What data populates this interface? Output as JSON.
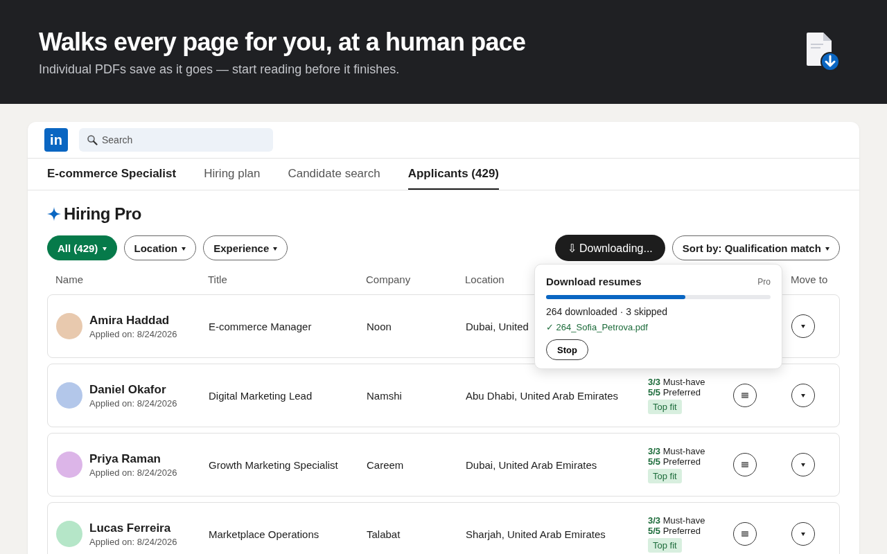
{
  "banner": {
    "headline": "Walks every page for you, at a human pace",
    "subtitle": "Individual PDFs save as it goes — start reading before it finishes."
  },
  "topbar": {
    "logo": "in",
    "search": {
      "placeholder": "Search"
    }
  },
  "tabs": [
    {
      "label": "E-commerce Specialist",
      "kind": "job",
      "selected": false
    },
    {
      "label": "Hiring plan",
      "kind": "tab",
      "selected": false
    },
    {
      "label": "Candidate search",
      "kind": "tab",
      "selected": false
    },
    {
      "label": "Applicants (429)",
      "kind": "tab",
      "selected": true
    }
  ],
  "section_title": "Hiring Pro",
  "filters": [
    {
      "label": "All (429)",
      "selected": true
    },
    {
      "label": "Location",
      "selected": false
    },
    {
      "label": "Experience",
      "selected": false
    }
  ],
  "download_button": "⇩ Downloading...",
  "sort_button": "Sort by: Qualification match",
  "columns": [
    "Name",
    "Title",
    "Company",
    "Location",
    "Move to"
  ],
  "applicants": [
    {
      "name": "Amira Haddad",
      "applied": "Applied on: 8/24/2026",
      "title": "E-commerce Manager",
      "company": "Noon",
      "location": "Dubai, United",
      "color": "#e8c9ae"
    },
    {
      "name": "Daniel Okafor",
      "applied": "Applied on: 8/24/2026",
      "title": "Digital Marketing Lead",
      "company": "Namshi",
      "location": "Abu Dhabi, United Arab Emirates",
      "color": "#b3c7ea",
      "must": "3/3",
      "must_label": "Must-have",
      "pref": "5/5",
      "pref_label": "Preferred",
      "badge": "Top fit"
    },
    {
      "name": "Priya Raman",
      "applied": "Applied on: 8/24/2026",
      "title": "Growth Marketing Specialist",
      "company": "Careem",
      "location": "Dubai, United Arab Emirates",
      "color": "#dcb5e8",
      "must": "3/3",
      "must_label": "Must-have",
      "pref": "5/5",
      "pref_label": "Preferred",
      "badge": "Top fit"
    },
    {
      "name": "Lucas Ferreira",
      "applied": "Applied on: 8/24/2026",
      "title": "Marketplace Operations",
      "company": "Talabat",
      "location": "Sharjah, United Arab Emirates",
      "color": "#b5e6c8",
      "must": "3/3",
      "must_label": "Must-have",
      "pref": "5/5",
      "pref_label": "Preferred",
      "badge": "Top fit"
    }
  ],
  "popover": {
    "title": "Download resumes",
    "tag": "Pro",
    "level": 0.62,
    "status": "264 downloaded · 3 skipped",
    "last_file": "✓ 264_Sofia_Petrova.pdf",
    "stop": "Stop"
  }
}
